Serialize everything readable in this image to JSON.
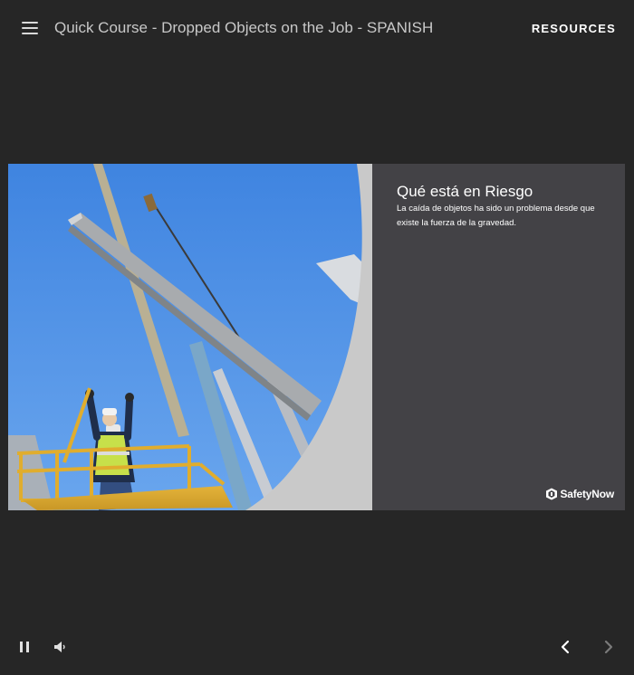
{
  "header": {
    "title": "Quick Course - Dropped Objects on the Job - SPANISH",
    "resources_label": "RESOURCES"
  },
  "slide": {
    "heading": "Qué está en Riesgo",
    "body": "La caída de objetos ha sido un problema desde que existe la fuerza de la gravedad.",
    "brand": "SafetyNow"
  },
  "icons": {
    "menu": "hamburger-menu-icon",
    "pause": "pause-icon",
    "volume": "volume-icon",
    "prev": "chevron-left-icon",
    "next": "chevron-right-icon"
  },
  "colors": {
    "background": "#262626",
    "panel": "#434246",
    "sky": "#4f8fe3",
    "curve": "#c9c9c9",
    "text": "#ffffff",
    "title_text": "#c8c8c8",
    "next_disabled": "#7a7a7a"
  }
}
